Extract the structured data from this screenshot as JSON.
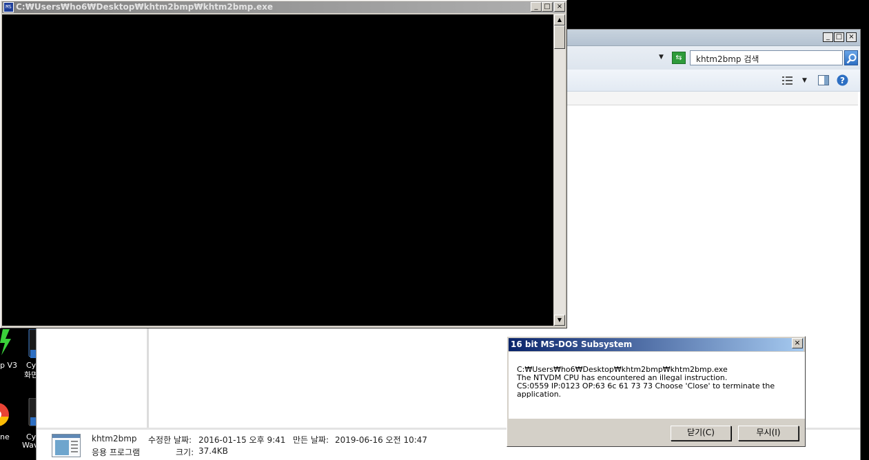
{
  "console_window": {
    "title": "C:₩Users₩ho6₩Desktop₩khtm2bmp₩khtm2bmp.exe",
    "icon": "ms-dos-icon",
    "controls": {
      "minimize": "_",
      "maximize": "□",
      "close": "×"
    }
  },
  "explorer_window": {
    "controls": {
      "minimize": "_",
      "maximize": "□",
      "close": "×"
    },
    "search": {
      "value": "khtm2bmp 검색"
    },
    "details": {
      "file_name": "khtm2bmp",
      "file_type": "응용 프로그램",
      "modified_label": "수정한 날짜:",
      "modified_value": "2016-01-15 오후 9:41",
      "created_label": "만든 날짜:",
      "created_value": "2019-06-16 오전 10:47",
      "size_label": "크기:",
      "size_value": "37.4KB"
    }
  },
  "desktop_icons": [
    {
      "label": "p V3",
      "icon": "v3-lightning-icon"
    },
    {
      "label": "Cy",
      "label2": "화면",
      "icon": "cyberlink-icon"
    },
    {
      "label": "ne",
      "icon": "chrome-icon"
    },
    {
      "label": "Cy",
      "label2": "Wav",
      "icon": "cyberlink-wave-icon"
    }
  ],
  "error_dialog": {
    "title": "16 bit MS-DOS Subsystem",
    "lines": [
      "C:₩Users₩ho6₩Desktop₩khtm2bmp₩khtm2bmp.exe",
      "The NTVDM CPU has encountered an illegal instruction.",
      "CS:0559 IP:0123 OP:63 6c 61 73 73 Choose 'Close' to terminate the",
      "application."
    ],
    "close_button": "닫기(C)",
    "ignore_button": "무시(I)",
    "close_x": "×"
  },
  "colors": {
    "dialog_title_start": "#0a246a",
    "dialog_title_end": "#a6caf0",
    "console_title_inactive": "#808080",
    "refresh_green": "#2e9b3a"
  }
}
